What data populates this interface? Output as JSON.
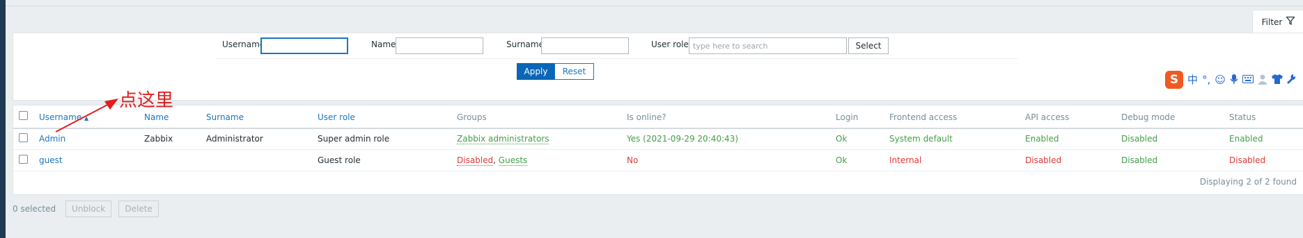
{
  "filter": {
    "tab_label": "Filter",
    "username_label": "Username",
    "username_value": "",
    "name_label": "Name",
    "name_value": "",
    "surname_label": "Surname",
    "surname_value": "",
    "user_roles_label": "User roles",
    "user_roles_placeholder": "type here to search",
    "select_label": "Select",
    "apply_label": "Apply",
    "reset_label": "Reset"
  },
  "ime_toolbar": {
    "logo": "S",
    "icons": [
      "中",
      "°,",
      "☺",
      "mic-icon",
      "keyboard-icon",
      "user-icon",
      "shirt-icon",
      "wrench-icon"
    ]
  },
  "table": {
    "headers": {
      "username": "Username",
      "sort_arrow": "▲",
      "name": "Name",
      "surname": "Surname",
      "user_role": "User role",
      "groups": "Groups",
      "is_online": "Is online?",
      "login": "Login",
      "frontend_access": "Frontend access",
      "api_access": "API access",
      "debug_mode": "Debug mode",
      "status": "Status"
    },
    "rows": [
      {
        "username": "Admin",
        "name": "Zabbix",
        "surname": "Administrator",
        "user_role": "Super admin role",
        "groups": [
          "Zabbix administrators"
        ],
        "is_online": "Yes (2021-09-29 20:40:43)",
        "login": "Ok",
        "frontend_access": "System default",
        "api_access": "Enabled",
        "debug_mode": "Disabled",
        "status": "Enabled"
      },
      {
        "username": "guest",
        "name": "",
        "surname": "",
        "user_role": "Guest role",
        "groups": [
          "Disabled",
          "Guests"
        ],
        "group_separator": ",",
        "is_online": "No",
        "login": "Ok",
        "frontend_access": "Internal",
        "api_access": "Disabled",
        "debug_mode": "Disabled",
        "status": "Disabled"
      }
    ],
    "footer": "Displaying 2 of 2 found"
  },
  "actions": {
    "selected_count": "0 selected",
    "unblock_label": "Unblock",
    "delete_label": "Delete"
  },
  "annotation": {
    "text": "点这里",
    "color": "#e21d1d"
  },
  "colors": {
    "link_blue": "#1a75bc",
    "status_green": "#429e47",
    "status_red": "#e33734",
    "apply_button": "#0a66b6"
  }
}
